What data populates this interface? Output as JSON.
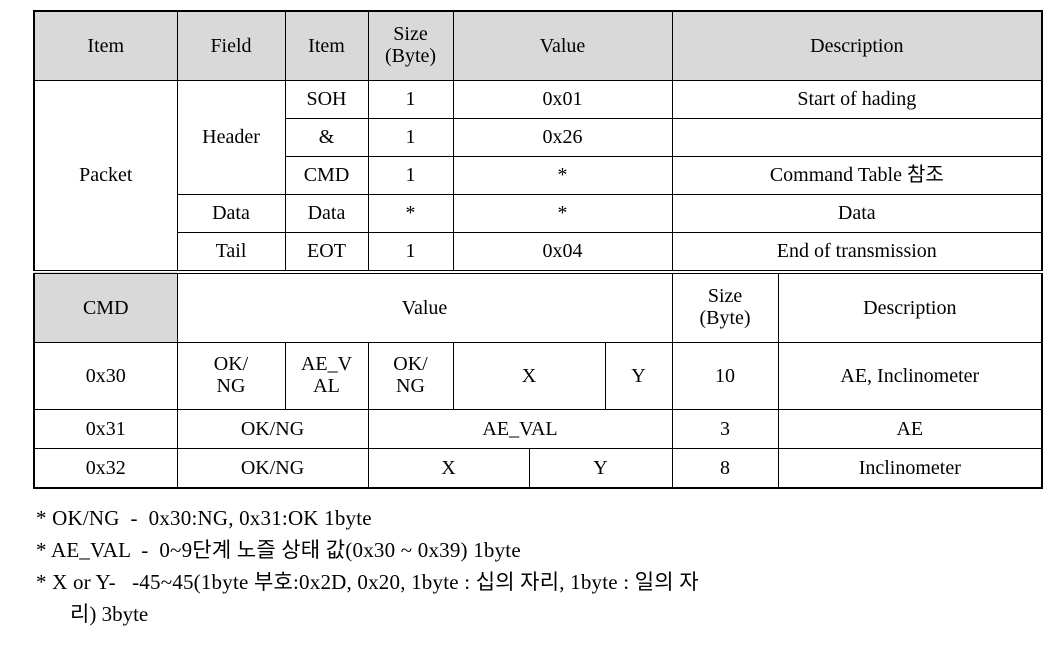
{
  "document": {
    "title": "Packet / CMD specification table"
  },
  "packet_table": {
    "headers": [
      "Item",
      "Field",
      "Item",
      "Size\n(Byte)",
      "Value",
      "Description"
    ],
    "header_cells": {
      "item1": "Item",
      "field": "Field",
      "item2": "Item",
      "size_line1": "Size",
      "size_line2": "(Byte)",
      "value": "Value",
      "description": "Description"
    },
    "group_label": "Packet",
    "rows": [
      {
        "field": "Header",
        "item": "SOH",
        "size": "1",
        "value": "0x01",
        "description": "Start of hading"
      },
      {
        "field": "Header",
        "item": "&",
        "size": "1",
        "value": "0x26",
        "description": ""
      },
      {
        "field": "Header",
        "item": "CMD",
        "size": "1",
        "value": "*",
        "description": "Command Table 참조"
      },
      {
        "field": "Data",
        "item": "Data",
        "size": "*",
        "value": "*",
        "description": "Data"
      },
      {
        "field": "Tail",
        "item": "EOT",
        "size": "1",
        "value": "0x04",
        "description": "End of transmission"
      }
    ]
  },
  "cmd_table": {
    "header_cells": {
      "cmd": "CMD",
      "value": "Value",
      "size_line1": "Size",
      "size_line2": "(Byte)",
      "description": "Description"
    },
    "rows": [
      {
        "cmd": "0x30",
        "values": [
          {
            "line1": "OK/",
            "line2": "NG"
          },
          {
            "line1": "AE_V",
            "line2": "AL"
          },
          {
            "line1": "OK/",
            "line2": "NG"
          },
          {
            "line1": "X",
            "line2": ""
          },
          {
            "line1": "Y",
            "line2": ""
          }
        ],
        "size": "10",
        "description": "AE, Inclinometer"
      },
      {
        "cmd": "0x31",
        "values": [
          {
            "line1": "OK/NG",
            "line2": ""
          },
          {
            "line1": "AE_VAL",
            "line2": ""
          }
        ],
        "size": "3",
        "description": "AE"
      },
      {
        "cmd": "0x32",
        "values": [
          {
            "line1": "OK/NG",
            "line2": ""
          },
          {
            "line1": "X",
            "line2": ""
          },
          {
            "line1": "Y",
            "line2": ""
          }
        ],
        "size": "8",
        "description": "Inclinometer"
      }
    ]
  },
  "notes": {
    "line1": "* OK/NG  -  0x30:NG, 0x31:OK 1byte",
    "line2": "* AE_VAL  -  0~9단계 노즐 상태 값(0x30 ~ 0x39) 1byte",
    "line3": "* X or Y-   -45~45(1byte 부호:0x2D, 0x20, 1byte : 십의 자리, 1byte : 일의 자",
    "line4": "리) 3byte"
  }
}
